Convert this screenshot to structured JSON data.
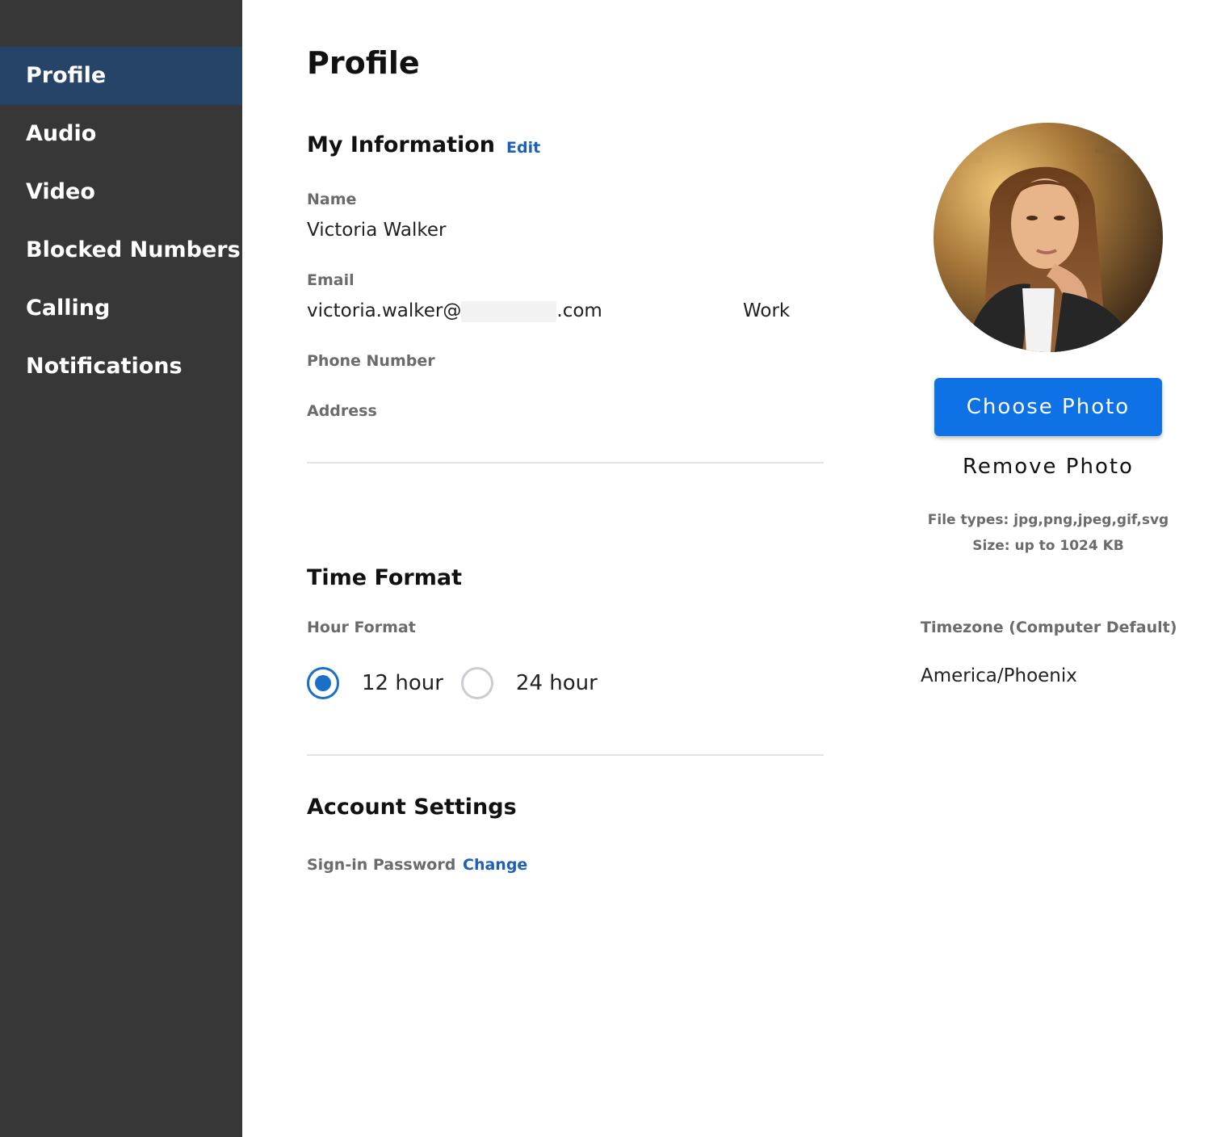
{
  "sidebar": {
    "items": [
      {
        "label": "Profile",
        "active": true
      },
      {
        "label": "Audio"
      },
      {
        "label": "Video"
      },
      {
        "label": "Blocked Numbers"
      },
      {
        "label": "Calling"
      },
      {
        "label": "Notifications"
      }
    ]
  },
  "page": {
    "title": "Profile"
  },
  "my_information": {
    "title": "My Information",
    "edit_label": "Edit",
    "name_label": "Name",
    "name_value": "Victoria Walker",
    "email_label": "Email",
    "email_prefix": "victoria.walker@",
    "email_suffix": ".com",
    "email_type": "Work",
    "phone_label": "Phone Number",
    "address_label": "Address"
  },
  "photo": {
    "choose_label": "Choose Photo",
    "remove_label": "Remove Photo",
    "file_types": "File types: jpg,png,jpeg,gif,svg",
    "size_limit": "Size: up to 1024 KB"
  },
  "time_format": {
    "title": "Time Format",
    "hour_format_label": "Hour Format",
    "options": [
      {
        "label": "12 hour",
        "selected": true
      },
      {
        "label": "24 hour",
        "selected": false
      }
    ],
    "timezone_label": "Timezone (Computer Default)",
    "timezone_value": "America/Phoenix"
  },
  "account_settings": {
    "title": "Account Settings",
    "password_label": "Sign-in Password",
    "change_label": "Change"
  },
  "colors": {
    "sidebar_bg": "#373737",
    "sidebar_active": "#264468",
    "accent": "#0e72e6",
    "link": "#1f5fb8"
  }
}
